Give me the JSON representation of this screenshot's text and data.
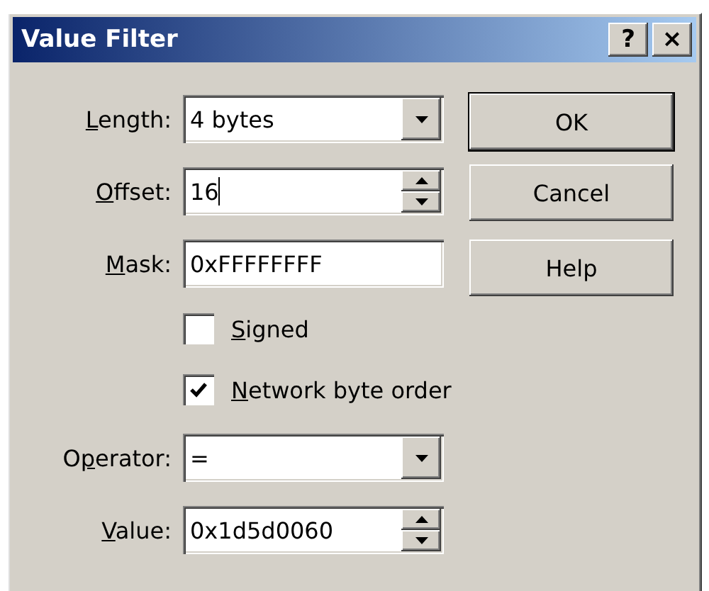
{
  "window": {
    "title": "Value Filter",
    "title_buttons": [
      "?",
      "×"
    ]
  },
  "fields": [
    {
      "kind": "dropdown",
      "label": {
        "key": "L",
        "post": "ength:"
      },
      "value": "4 bytes"
    },
    {
      "kind": "spin",
      "label": {
        "key": "O",
        "post": "ffset:"
      },
      "value": "16",
      "focused": true
    },
    {
      "kind": "text",
      "label": {
        "key": "M",
        "post": "ask:"
      },
      "value": "0xFFFFFFFF"
    }
  ],
  "checkboxes": [
    {
      "label": {
        "key": "S",
        "post": "igned"
      },
      "checked": false
    },
    {
      "label": {
        "key": "N",
        "post": "etwork byte order"
      },
      "checked": true
    }
  ],
  "fields_lower": [
    {
      "kind": "dropdown",
      "label": {
        "pre": "O",
        "key": "p",
        "post": "erator:"
      },
      "value": "="
    },
    {
      "kind": "spin",
      "label": {
        "key": "V",
        "post": "alue:"
      },
      "value": "0x1d5d0060"
    }
  ],
  "buttons": [
    {
      "label": "OK",
      "default": true
    },
    {
      "label": "Cancel",
      "default": false
    },
    {
      "label": "Help",
      "default": false
    }
  ]
}
